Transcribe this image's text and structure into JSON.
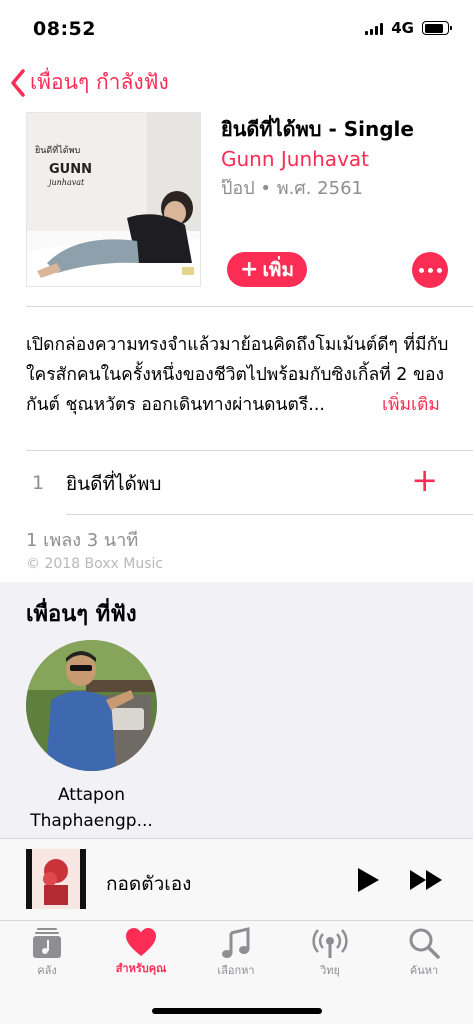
{
  "status": {
    "time": "08:52",
    "network": "4G",
    "battery_level": 0.85
  },
  "nav": {
    "back_label": "เพื่อนๆ กำลังฟัง"
  },
  "album": {
    "art_title": "ยินดีที่ได้พบ",
    "art_artist": "GUNN",
    "art_artist_sub": "junhavat",
    "title": "ยินดีที่ได้พบ - Single",
    "artist": "Gunn Junhavat",
    "meta": "ป๊อป • พ.ศ. 2561",
    "add_label": "เพิ่ม"
  },
  "description": {
    "text": "เปิดกล่องความทรงจำแล้วมาย้อนคิดถึงโมเม้นต์ดีๆ ที่มีกับใครสักคนในครั้งหนึ่งของชีวิตไปพร้อมกับซิงเกิ้ลที่ 2 ของ กันต์ ชุณหวัตร ออกเดินทางผ่านดนตรี...",
    "more_label": "เพิ่มเติม"
  },
  "tracks": [
    {
      "number": "1",
      "title": "ยินดีที่ได้พบ"
    }
  ],
  "summary": {
    "count_duration": "1 เพลง 3 นาที",
    "copyright": "© 2018 Boxx Music"
  },
  "friends": {
    "heading": "เพื่อนๆ ที่ฟัง",
    "items": [
      {
        "name": "Attapon Thaphaengp..."
      }
    ]
  },
  "now_playing": {
    "title": "กอดตัวเอง"
  },
  "tabs": [
    {
      "label": "คลัง",
      "icon": "library-icon"
    },
    {
      "label": "สำหรับคุณ",
      "icon": "heart-icon",
      "active": true
    },
    {
      "label": "เลือกหา",
      "icon": "music-note-icon"
    },
    {
      "label": "วิทยุ",
      "icon": "radio-icon"
    },
    {
      "label": "ค้นหา",
      "icon": "search-icon"
    }
  ],
  "colors": {
    "accent": "#fb2d55",
    "secondary_text": "#8e8e93",
    "section_bg": "#f2f2f6"
  }
}
